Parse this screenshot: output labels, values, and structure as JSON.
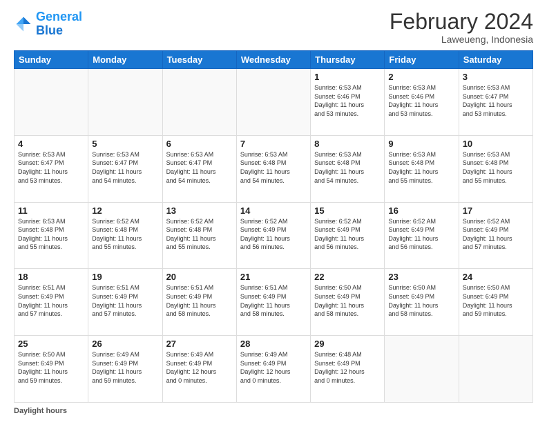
{
  "header": {
    "logo_general": "General",
    "logo_blue": "Blue",
    "title": "February 2024",
    "subtitle": "Laweueng, Indonesia"
  },
  "days_of_week": [
    "Sunday",
    "Monday",
    "Tuesday",
    "Wednesday",
    "Thursday",
    "Friday",
    "Saturday"
  ],
  "legend_label": "Daylight hours",
  "weeks": [
    [
      {
        "day": "",
        "info": ""
      },
      {
        "day": "",
        "info": ""
      },
      {
        "day": "",
        "info": ""
      },
      {
        "day": "",
        "info": ""
      },
      {
        "day": "1",
        "info": "Sunrise: 6:53 AM\nSunset: 6:46 PM\nDaylight: 11 hours\nand 53 minutes."
      },
      {
        "day": "2",
        "info": "Sunrise: 6:53 AM\nSunset: 6:46 PM\nDaylight: 11 hours\nand 53 minutes."
      },
      {
        "day": "3",
        "info": "Sunrise: 6:53 AM\nSunset: 6:47 PM\nDaylight: 11 hours\nand 53 minutes."
      }
    ],
    [
      {
        "day": "4",
        "info": "Sunrise: 6:53 AM\nSunset: 6:47 PM\nDaylight: 11 hours\nand 53 minutes."
      },
      {
        "day": "5",
        "info": "Sunrise: 6:53 AM\nSunset: 6:47 PM\nDaylight: 11 hours\nand 54 minutes."
      },
      {
        "day": "6",
        "info": "Sunrise: 6:53 AM\nSunset: 6:47 PM\nDaylight: 11 hours\nand 54 minutes."
      },
      {
        "day": "7",
        "info": "Sunrise: 6:53 AM\nSunset: 6:48 PM\nDaylight: 11 hours\nand 54 minutes."
      },
      {
        "day": "8",
        "info": "Sunrise: 6:53 AM\nSunset: 6:48 PM\nDaylight: 11 hours\nand 54 minutes."
      },
      {
        "day": "9",
        "info": "Sunrise: 6:53 AM\nSunset: 6:48 PM\nDaylight: 11 hours\nand 55 minutes."
      },
      {
        "day": "10",
        "info": "Sunrise: 6:53 AM\nSunset: 6:48 PM\nDaylight: 11 hours\nand 55 minutes."
      }
    ],
    [
      {
        "day": "11",
        "info": "Sunrise: 6:53 AM\nSunset: 6:48 PM\nDaylight: 11 hours\nand 55 minutes."
      },
      {
        "day": "12",
        "info": "Sunrise: 6:52 AM\nSunset: 6:48 PM\nDaylight: 11 hours\nand 55 minutes."
      },
      {
        "day": "13",
        "info": "Sunrise: 6:52 AM\nSunset: 6:48 PM\nDaylight: 11 hours\nand 55 minutes."
      },
      {
        "day": "14",
        "info": "Sunrise: 6:52 AM\nSunset: 6:49 PM\nDaylight: 11 hours\nand 56 minutes."
      },
      {
        "day": "15",
        "info": "Sunrise: 6:52 AM\nSunset: 6:49 PM\nDaylight: 11 hours\nand 56 minutes."
      },
      {
        "day": "16",
        "info": "Sunrise: 6:52 AM\nSunset: 6:49 PM\nDaylight: 11 hours\nand 56 minutes."
      },
      {
        "day": "17",
        "info": "Sunrise: 6:52 AM\nSunset: 6:49 PM\nDaylight: 11 hours\nand 57 minutes."
      }
    ],
    [
      {
        "day": "18",
        "info": "Sunrise: 6:51 AM\nSunset: 6:49 PM\nDaylight: 11 hours\nand 57 minutes."
      },
      {
        "day": "19",
        "info": "Sunrise: 6:51 AM\nSunset: 6:49 PM\nDaylight: 11 hours\nand 57 minutes."
      },
      {
        "day": "20",
        "info": "Sunrise: 6:51 AM\nSunset: 6:49 PM\nDaylight: 11 hours\nand 58 minutes."
      },
      {
        "day": "21",
        "info": "Sunrise: 6:51 AM\nSunset: 6:49 PM\nDaylight: 11 hours\nand 58 minutes."
      },
      {
        "day": "22",
        "info": "Sunrise: 6:50 AM\nSunset: 6:49 PM\nDaylight: 11 hours\nand 58 minutes."
      },
      {
        "day": "23",
        "info": "Sunrise: 6:50 AM\nSunset: 6:49 PM\nDaylight: 11 hours\nand 58 minutes."
      },
      {
        "day": "24",
        "info": "Sunrise: 6:50 AM\nSunset: 6:49 PM\nDaylight: 11 hours\nand 59 minutes."
      }
    ],
    [
      {
        "day": "25",
        "info": "Sunrise: 6:50 AM\nSunset: 6:49 PM\nDaylight: 11 hours\nand 59 minutes."
      },
      {
        "day": "26",
        "info": "Sunrise: 6:49 AM\nSunset: 6:49 PM\nDaylight: 11 hours\nand 59 minutes."
      },
      {
        "day": "27",
        "info": "Sunrise: 6:49 AM\nSunset: 6:49 PM\nDaylight: 12 hours\nand 0 minutes."
      },
      {
        "day": "28",
        "info": "Sunrise: 6:49 AM\nSunset: 6:49 PM\nDaylight: 12 hours\nand 0 minutes."
      },
      {
        "day": "29",
        "info": "Sunrise: 6:48 AM\nSunset: 6:49 PM\nDaylight: 12 hours\nand 0 minutes."
      },
      {
        "day": "",
        "info": ""
      },
      {
        "day": "",
        "info": ""
      }
    ]
  ]
}
